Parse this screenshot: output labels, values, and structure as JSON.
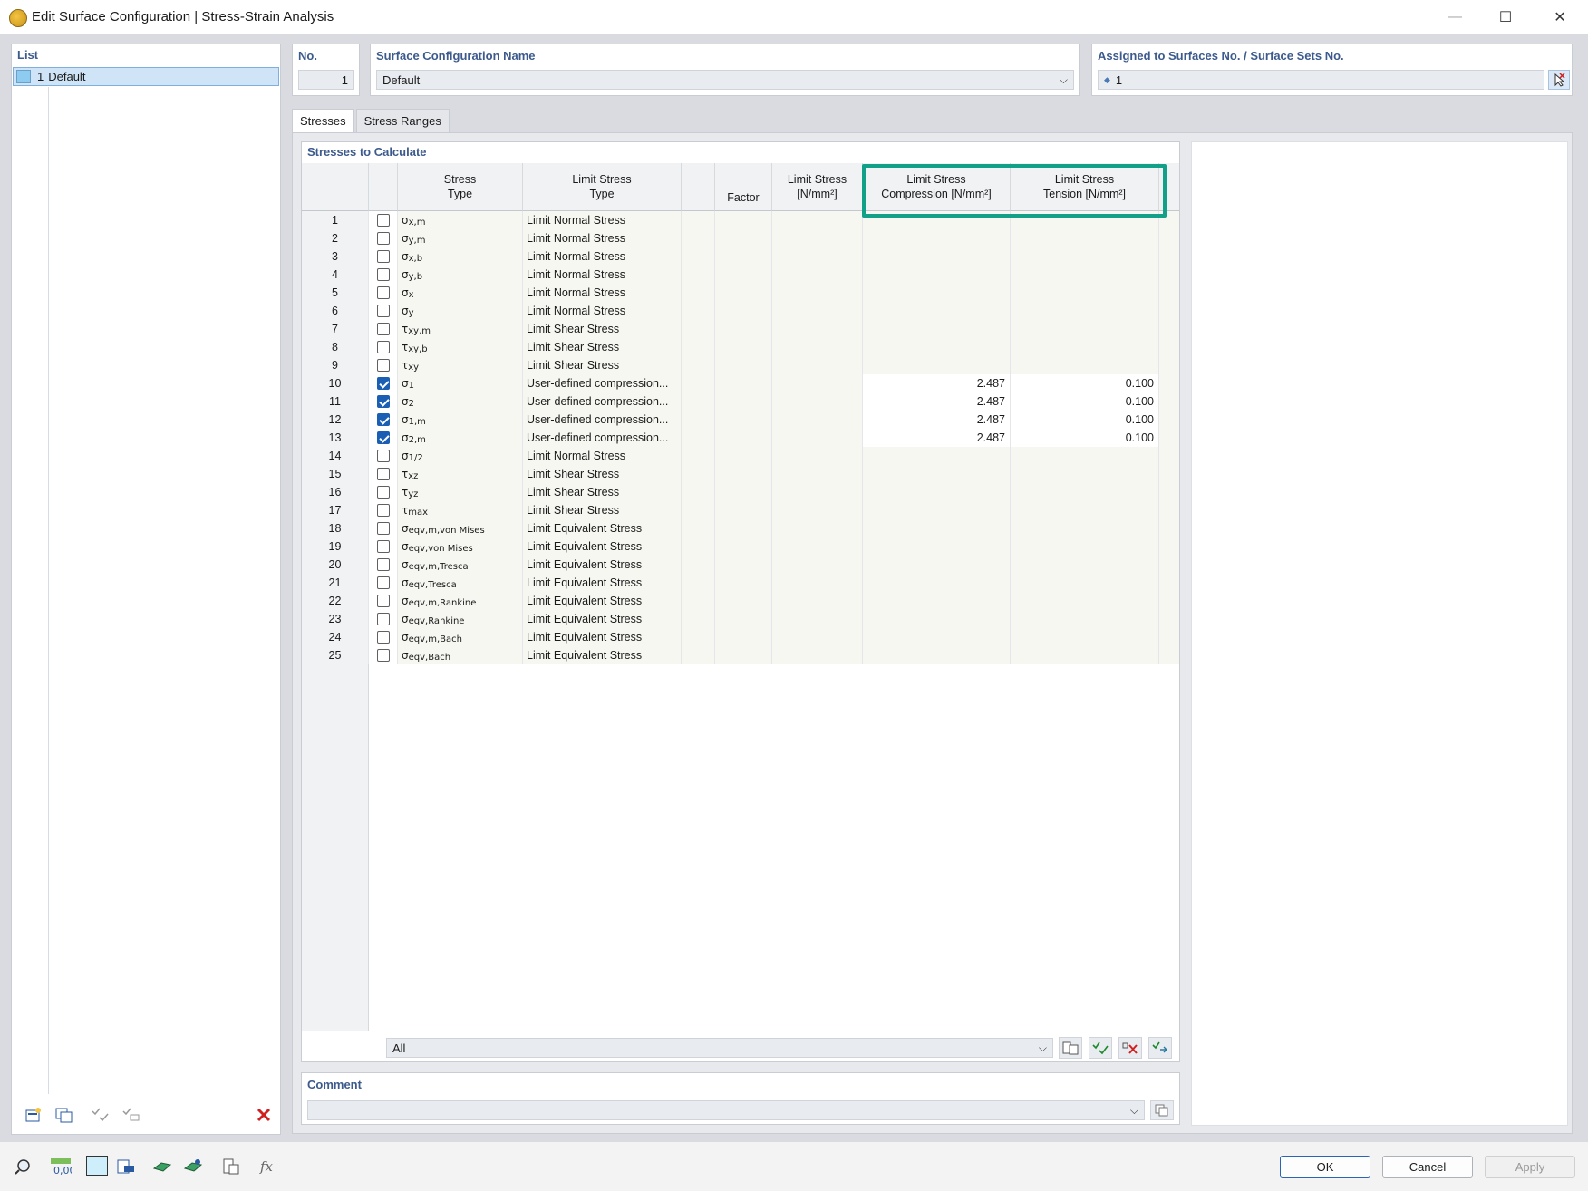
{
  "window": {
    "title": "Edit Surface Configuration | Stress-Strain Analysis",
    "minimize_glyph": "—",
    "maximize_glyph": "☐",
    "close_glyph": "✕"
  },
  "list_panel": {
    "header": "List",
    "items": [
      {
        "no": "1",
        "name": "Default"
      }
    ]
  },
  "fields": {
    "no_label": "No.",
    "no_value": "1",
    "name_label": "Surface Configuration Name",
    "name_value": "Default",
    "assigned_label": "Assigned to Surfaces No. / Surface Sets No.",
    "assigned_value": "1"
  },
  "tabs": [
    {
      "label": "Stresses"
    },
    {
      "label": "Stress Ranges"
    }
  ],
  "stresses": {
    "section_title": "Stresses to Calculate",
    "headers": {
      "stress_type_1": "Stress",
      "stress_type_2": "Type",
      "limit_type_1": "Limit Stress",
      "limit_type_2": "Type",
      "factor": "Factor",
      "limit_stress_1": "Limit Stress",
      "limit_stress_2": "[N/mm²]",
      "compression_1": "Limit Stress",
      "compression_2": "Compression [N/mm²]",
      "tension_1": "Limit Stress",
      "tension_2": "Tension [N/mm²]"
    },
    "rows": [
      {
        "no": "1",
        "checked": false,
        "sym": "σ",
        "sub": "x,m",
        "limit_type": "Limit Normal Stress",
        "compression": "",
        "tension": ""
      },
      {
        "no": "2",
        "checked": false,
        "sym": "σ",
        "sub": "y,m",
        "limit_type": "Limit Normal Stress",
        "compression": "",
        "tension": ""
      },
      {
        "no": "3",
        "checked": false,
        "sym": "σ",
        "sub": "x,b",
        "limit_type": "Limit Normal Stress",
        "compression": "",
        "tension": ""
      },
      {
        "no": "4",
        "checked": false,
        "sym": "σ",
        "sub": "y,b",
        "limit_type": "Limit Normal Stress",
        "compression": "",
        "tension": ""
      },
      {
        "no": "5",
        "checked": false,
        "sym": "σ",
        "sub": "x",
        "limit_type": "Limit Normal Stress",
        "compression": "",
        "tension": ""
      },
      {
        "no": "6",
        "checked": false,
        "sym": "σ",
        "sub": "y",
        "limit_type": "Limit Normal Stress",
        "compression": "",
        "tension": ""
      },
      {
        "no": "7",
        "checked": false,
        "sym": "τ",
        "sub": "xy,m",
        "limit_type": "Limit Shear Stress",
        "compression": "",
        "tension": ""
      },
      {
        "no": "8",
        "checked": false,
        "sym": "τ",
        "sub": "xy,b",
        "limit_type": "Limit Shear Stress",
        "compression": "",
        "tension": ""
      },
      {
        "no": "9",
        "checked": false,
        "sym": "τ",
        "sub": "xy",
        "limit_type": "Limit Shear Stress",
        "compression": "",
        "tension": ""
      },
      {
        "no": "10",
        "checked": true,
        "sym": "σ",
        "sub": "1",
        "limit_type": "User-defined compression...",
        "compression": "2.487",
        "tension": "0.100"
      },
      {
        "no": "11",
        "checked": true,
        "sym": "σ",
        "sub": "2",
        "limit_type": "User-defined compression...",
        "compression": "2.487",
        "tension": "0.100"
      },
      {
        "no": "12",
        "checked": true,
        "sym": "σ",
        "sub": "1,m",
        "limit_type": "User-defined compression...",
        "compression": "2.487",
        "tension": "0.100"
      },
      {
        "no": "13",
        "checked": true,
        "sym": "σ",
        "sub": "2,m",
        "limit_type": "User-defined compression...",
        "compression": "2.487",
        "tension": "0.100"
      },
      {
        "no": "14",
        "checked": false,
        "sym": "σ",
        "sub": "1/2",
        "limit_type": "Limit Normal Stress",
        "compression": "",
        "tension": ""
      },
      {
        "no": "15",
        "checked": false,
        "sym": "τ",
        "sub": "xz",
        "limit_type": "Limit Shear Stress",
        "compression": "",
        "tension": ""
      },
      {
        "no": "16",
        "checked": false,
        "sym": "τ",
        "sub": "yz",
        "limit_type": "Limit Shear Stress",
        "compression": "",
        "tension": ""
      },
      {
        "no": "17",
        "checked": false,
        "sym": "τ",
        "sub": "max",
        "limit_type": "Limit Shear Stress",
        "compression": "",
        "tension": ""
      },
      {
        "no": "18",
        "checked": false,
        "sym": "σ",
        "sub": "eqv,m,von Mises",
        "limit_type": "Limit Equivalent Stress",
        "compression": "",
        "tension": ""
      },
      {
        "no": "19",
        "checked": false,
        "sym": "σ",
        "sub": "eqv,von Mises",
        "limit_type": "Limit Equivalent Stress",
        "compression": "",
        "tension": ""
      },
      {
        "no": "20",
        "checked": false,
        "sym": "σ",
        "sub": "eqv,m,Tresca",
        "limit_type": "Limit Equivalent Stress",
        "compression": "",
        "tension": ""
      },
      {
        "no": "21",
        "checked": false,
        "sym": "σ",
        "sub": "eqv,Tresca",
        "limit_type": "Limit Equivalent Stress",
        "compression": "",
        "tension": ""
      },
      {
        "no": "22",
        "checked": false,
        "sym": "σ",
        "sub": "eqv,m,Rankine",
        "limit_type": "Limit Equivalent Stress",
        "compression": "",
        "tension": ""
      },
      {
        "no": "23",
        "checked": false,
        "sym": "σ",
        "sub": "eqv,Rankine",
        "limit_type": "Limit Equivalent Stress",
        "compression": "",
        "tension": ""
      },
      {
        "no": "24",
        "checked": false,
        "sym": "σ",
        "sub": "eqv,m,Bach",
        "limit_type": "Limit Equivalent Stress",
        "compression": "",
        "tension": ""
      },
      {
        "no": "25",
        "checked": false,
        "sym": "σ",
        "sub": "eqv,Bach",
        "limit_type": "Limit Equivalent Stress",
        "compression": "",
        "tension": ""
      }
    ],
    "filter_value": "All"
  },
  "comment": {
    "label": "Comment",
    "value": ""
  },
  "buttons": {
    "ok": "OK",
    "cancel": "Cancel",
    "apply": "Apply"
  },
  "colors": {
    "highlight": "#12a089",
    "checkbox_on": "#1a5fb4",
    "header_text": "#3c5a8c"
  }
}
